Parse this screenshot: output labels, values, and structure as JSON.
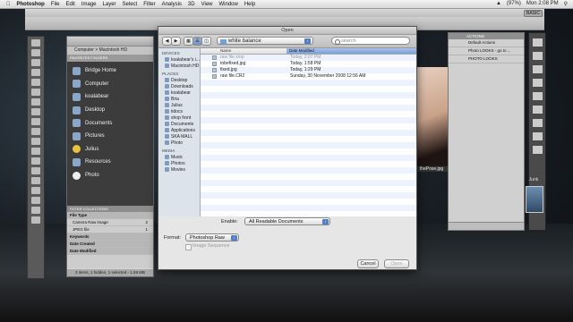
{
  "menubar": {
    "apple": "",
    "items": [
      "Photoshop",
      "File",
      "Edit",
      "Image",
      "Layer",
      "Select",
      "Filter",
      "Analysis",
      "3D",
      "View",
      "Window",
      "Help"
    ],
    "battery": "(97%)",
    "clock": "Mon 2:08 PM"
  },
  "photoshop": {
    "workspace": "BASIC"
  },
  "bridge": {
    "path": "Computer > Macintosh HD",
    "tabs": "FAVORITES  FOLDERS",
    "favorites": [
      "Bridge Home",
      "Computer",
      "koalabear",
      "Desktop",
      "Documents",
      "Pictures",
      "Julius",
      "Resources",
      "Photo"
    ],
    "filter_header": "FILTER  COLLECTIONS",
    "filters": [
      {
        "label": "File Type",
        "count": "",
        "header": true
      },
      {
        "label": "Camera Raw image",
        "count": "2",
        "header": false
      },
      {
        "label": "JPEG file",
        "count": "1",
        "header": false
      },
      {
        "label": "Keywords",
        "count": "",
        "header": true
      },
      {
        "label": "Date Created",
        "count": "",
        "header": true
      },
      {
        "label": "Date Modified",
        "count": "",
        "header": true
      }
    ],
    "status": "3 items, 1 hidden, 1 selected - 1.59 MB"
  },
  "actions_panel": {
    "title": "ACTIONS",
    "items": [
      "Default Actions",
      "Photo LOOKS - go to ...",
      "PHOTO LOOKS"
    ]
  },
  "photo_caption": "thePose.jpg",
  "junk_label": "Junk",
  "dialog": {
    "title": "Open",
    "folder": "white balance",
    "search_placeholder": "search",
    "sidebar": {
      "devices_header": "DEVICES",
      "devices": [
        "koalabear's i...",
        "Macintosh HD"
      ],
      "places_header": "PLACES",
      "places": [
        "Desktop",
        "Downloads",
        "koalabear",
        "Bria",
        "Julius",
        "tidocs",
        "shop front",
        "Documents",
        "Applications",
        "SKA MALL",
        "Photo"
      ],
      "media_header": "MEDIA",
      "media": [
        "Music",
        "Photos",
        "Movies"
      ]
    },
    "columns": {
      "name": "Name",
      "date": "Date Modified"
    },
    "files": [
      {
        "name": "raw file.xmp",
        "date": "Today, 2:07 PM",
        "dim": true
      },
      {
        "name": "tobefixed.jpg",
        "date": "Today, 1:58 PM",
        "dim": false
      },
      {
        "name": "fixed.jpg",
        "date": "Today, 1:29 PM",
        "dim": false
      },
      {
        "name": "raw file.CR2",
        "date": "Sunday, 30 November 2008 12:56 AM",
        "dim": false
      }
    ],
    "enable_label": "Enable:",
    "enable_value": "All Readable Documents",
    "format_label": "Format:",
    "format_value": "Photoshop Raw",
    "image_sequence_label": "Image Sequence",
    "cancel_label": "Cancel",
    "open_label": "Open"
  }
}
